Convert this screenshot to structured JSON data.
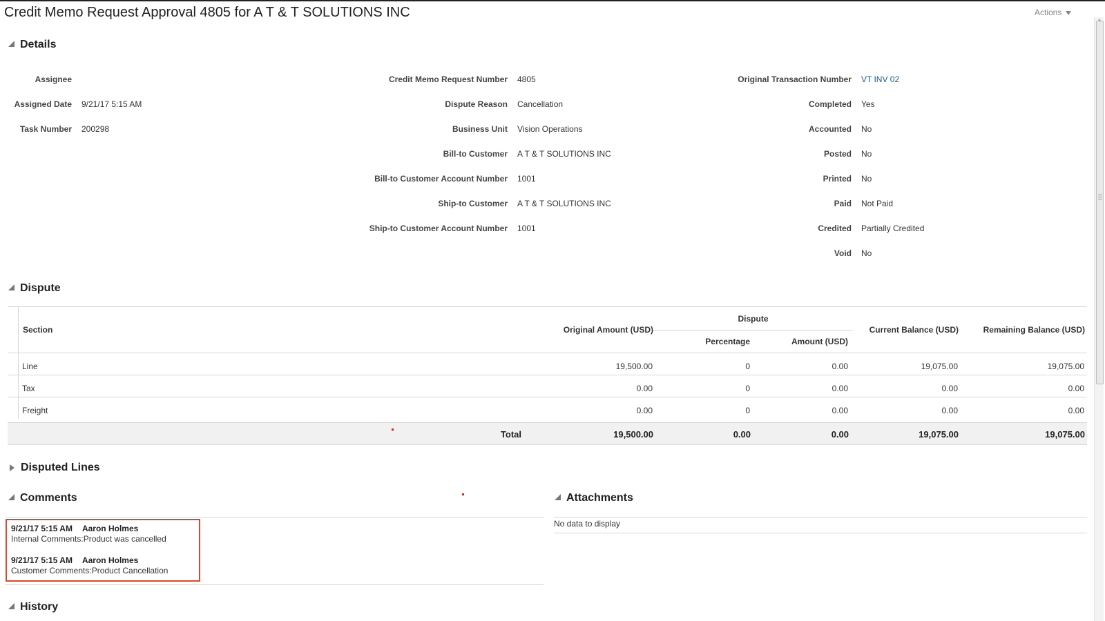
{
  "page": {
    "title": "Credit Memo Request Approval 4805 for A T & T SOLUTIONS INC",
    "actions_label": "Actions"
  },
  "details": {
    "heading": "Details",
    "col1": [
      {
        "label": "Assignee",
        "value": ""
      },
      {
        "label": "Assigned Date",
        "value": "9/21/17 5:15 AM"
      },
      {
        "label": "Task Number",
        "value": "200298"
      }
    ],
    "col2": [
      {
        "label": "Credit Memo Request Number",
        "value": "4805"
      },
      {
        "label": "Dispute Reason",
        "value": "Cancellation"
      },
      {
        "label": "Business Unit",
        "value": "Vision Operations"
      },
      {
        "label": "Bill-to Customer",
        "value": "A T & T SOLUTIONS INC"
      },
      {
        "label": "Bill-to Customer Account Number",
        "value": "1001"
      },
      {
        "label": "Ship-to Customer",
        "value": "A T & T SOLUTIONS INC"
      },
      {
        "label": "Ship-to Customer Account Number",
        "value": "1001"
      }
    ],
    "col3": [
      {
        "label": "Original Transaction Number",
        "value": "VT INV 02"
      },
      {
        "label": "Completed",
        "value": "Yes"
      },
      {
        "label": "Accounted",
        "value": "No"
      },
      {
        "label": "Posted",
        "value": "No"
      },
      {
        "label": "Printed",
        "value": "No"
      },
      {
        "label": "Paid",
        "value": "Not Paid"
      },
      {
        "label": "Credited",
        "value": "Partially Credited"
      },
      {
        "label": "Void",
        "value": "No"
      }
    ]
  },
  "dispute": {
    "heading": "Dispute",
    "headers": {
      "section": "Section",
      "original_amount": "Original Amount (USD)",
      "dispute_group": "Dispute",
      "percentage": "Percentage",
      "amount": "Amount (USD)",
      "current_balance": "Current Balance (USD)",
      "remaining_balance": "Remaining Balance (USD)"
    },
    "rows": [
      {
        "section": "Line",
        "original": "19,500.00",
        "percentage": "0",
        "amount": "0.00",
        "current": "19,075.00",
        "remaining": "19,075.00"
      },
      {
        "section": "Tax",
        "original": "0.00",
        "percentage": "0",
        "amount": "0.00",
        "current": "0.00",
        "remaining": "0.00"
      },
      {
        "section": "Freight",
        "original": "0.00",
        "percentage": "0",
        "amount": "0.00",
        "current": "0.00",
        "remaining": "0.00"
      }
    ],
    "total": {
      "label": "Total",
      "original": "19,500.00",
      "percentage": "0.00",
      "amount": "0.00",
      "current": "19,075.00",
      "remaining": "19,075.00"
    }
  },
  "disputed_lines": {
    "heading": "Disputed Lines"
  },
  "comments": {
    "heading": "Comments",
    "items": [
      {
        "time": "9/21/17 5:15 AM",
        "author": "Aaron Holmes",
        "text": "Internal Comments:Product was cancelled"
      },
      {
        "time": "9/21/17 5:15 AM",
        "author": "Aaron Holmes",
        "text": "Customer Comments:Product Cancellation"
      }
    ]
  },
  "attachments": {
    "heading": "Attachments",
    "empty_text": "No data to display"
  },
  "history": {
    "heading": "History"
  },
  "colors": {
    "link": "#145c9e",
    "highlight_border": "#d9482b",
    "total_row_bg": "#f1f1f1"
  }
}
